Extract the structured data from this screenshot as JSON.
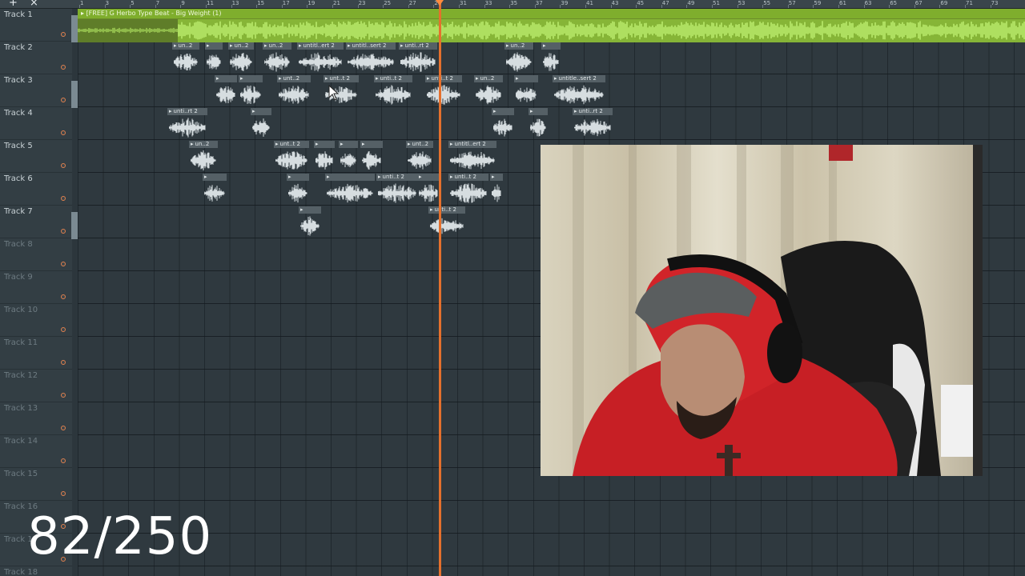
{
  "toolbar": {
    "add_icon": "plus-icon",
    "close_icon": "close-icon"
  },
  "ruler": {
    "ticks": [
      "1",
      "3",
      "5",
      "7",
      "9",
      "11",
      "13",
      "15",
      "17",
      "19",
      "21",
      "23",
      "25",
      "27",
      "29",
      "31",
      "33",
      "35",
      "37",
      "39",
      "41",
      "43",
      "45",
      "47",
      "49",
      "51",
      "53",
      "55",
      "57",
      "59",
      "61",
      "63",
      "65",
      "67",
      "69",
      "71",
      "73"
    ]
  },
  "tracks": [
    {
      "name": "Track 1",
      "empty": false
    },
    {
      "name": "Track 2",
      "empty": false
    },
    {
      "name": "Track 3",
      "empty": false
    },
    {
      "name": "Track 4",
      "empty": false
    },
    {
      "name": "Track 5",
      "empty": false
    },
    {
      "name": "Track 6",
      "empty": false
    },
    {
      "name": "Track 7",
      "empty": false
    },
    {
      "name": "Track 8",
      "empty": true
    },
    {
      "name": "Track 9",
      "empty": true
    },
    {
      "name": "Track 10",
      "empty": true
    },
    {
      "name": "Track 11",
      "empty": true
    },
    {
      "name": "Track 12",
      "empty": true
    },
    {
      "name": "Track 13",
      "empty": true
    },
    {
      "name": "Track 14",
      "empty": true
    },
    {
      "name": "Track 15",
      "empty": true
    },
    {
      "name": "Track 16",
      "empty": true
    },
    {
      "name": "Track 17",
      "empty": true
    },
    {
      "name": "Track 18",
      "empty": true
    }
  ],
  "beat_clip": {
    "title": "[FREE] G Herbo Type Beat - Big Weight (1)"
  },
  "clips": {
    "track2": [
      "un..2",
      "",
      "un..2",
      "un..2",
      "untitl..ert 2",
      "untitl..sert 2",
      "unti..rt 2",
      "un..2",
      ""
    ],
    "track3": [
      "",
      "",
      "unt..2",
      "unt..t 2",
      "unti..t 2",
      "unti..t 2",
      "un..2",
      "",
      "untitle..sert 2"
    ],
    "track4": [
      "unti..rt 2",
      "",
      "",
      "",
      "unti..rt 2"
    ],
    "track5": [
      "un..2",
      "unt..t 2",
      "",
      "",
      "",
      "unt..2",
      "untitl..ert 2"
    ],
    "track6": [
      "",
      "",
      "",
      "unti..t 2",
      "",
      "unti..t 2",
      ""
    ],
    "track7": [
      "",
      "unti..t 2"
    ]
  },
  "counter": {
    "text": "82/250"
  },
  "colors": {
    "beat": "#7fae2d",
    "playhead": "#e5702d",
    "clip_header": "#556066"
  }
}
